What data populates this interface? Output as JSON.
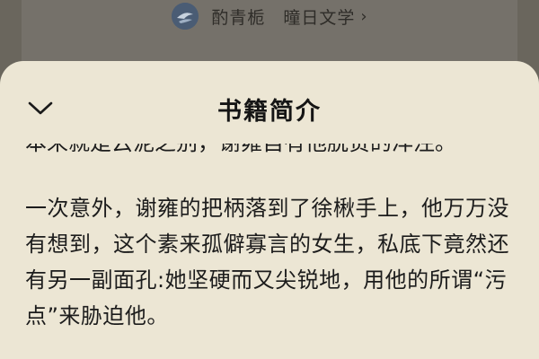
{
  "background": {
    "author_name": "酌青栀",
    "publisher_name": "曈日文学",
    "publisher_chevron": "›",
    "avatar_icon": "author-avatar-icon"
  },
  "sheet": {
    "title": "书籍简介",
    "collapse_icon": "chevron-down-icon",
    "clipped_line": "本来就是云泥之别，谢雍自有他脱贫的洋注。",
    "paragraph": "一次意外，谢雍的把柄落到了徐楸手上，他万万没有想到，这个素来孤僻寡言的女生，私底下竟然还有另一副面孔:她坚硬而又尖锐地，用他的所谓“污点”来胁迫他。"
  }
}
